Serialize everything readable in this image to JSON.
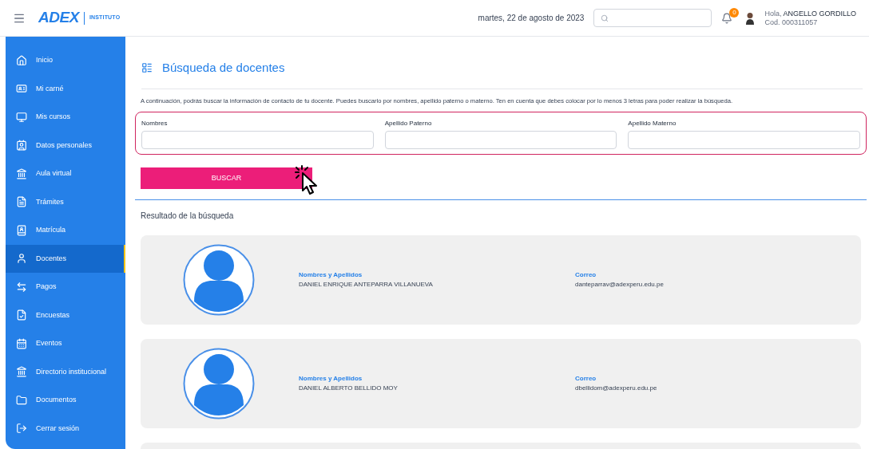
{
  "header": {
    "logo": "ADEX",
    "logo_sub": "INSTITUTO",
    "date": "martes, 22 de agosto de 2023",
    "notification_count": "0",
    "greeting": "Hola,",
    "user_name": "ANGELLO GORDILLO",
    "user_code": "Cod. 000311057"
  },
  "sidebar": {
    "items": [
      {
        "label": "Inicio",
        "selected": false
      },
      {
        "label": "Mi carné",
        "selected": false
      },
      {
        "label": "Mis cursos",
        "selected": false
      },
      {
        "label": "Datos personales",
        "selected": false
      },
      {
        "label": "Aula virtual",
        "selected": false
      },
      {
        "label": "Trámites",
        "selected": false
      },
      {
        "label": "Matrícula",
        "selected": false
      },
      {
        "label": "Docentes",
        "selected": true
      },
      {
        "label": "Pagos",
        "selected": false
      },
      {
        "label": "Encuestas",
        "selected": false
      },
      {
        "label": "Eventos",
        "selected": false
      },
      {
        "label": "Directorio institucional",
        "selected": false
      },
      {
        "label": "Documentos",
        "selected": false
      },
      {
        "label": "Cerrar sesión",
        "selected": false
      }
    ]
  },
  "page": {
    "title": "Búsqueda de docentes",
    "description": "A continuación, podrás buscar la información de contacto de tu docente. Puedes buscarlo por nombres, apellido paterno o materno. Ten en cuenta que debes colocar por lo menos 3 letras para poder realizar la búsqueda.",
    "fields": [
      {
        "label": "Nombres"
      },
      {
        "label": "Apellido Paterno"
      },
      {
        "label": "Apellido Materno"
      }
    ],
    "search_button": "BUSCAR",
    "results_title": "Resultado de la búsqueda",
    "results": [
      {
        "kind": "full",
        "name_label": "Nombres y Apellidos",
        "name": "DANIEL ENRIQUE ANTEPARRA VILLANUEVA",
        "email_label": "Correo",
        "email": "danteparrav@adexperu.edu.pe"
      },
      {
        "kind": "full",
        "name_label": "Nombres y Apellidos",
        "name": "DANIEL ALBERTO BELLIDO MOY",
        "email_label": "Correo",
        "email": "dbellidom@adexperu.edu.pe"
      },
      {
        "kind": "clipped"
      }
    ]
  }
}
